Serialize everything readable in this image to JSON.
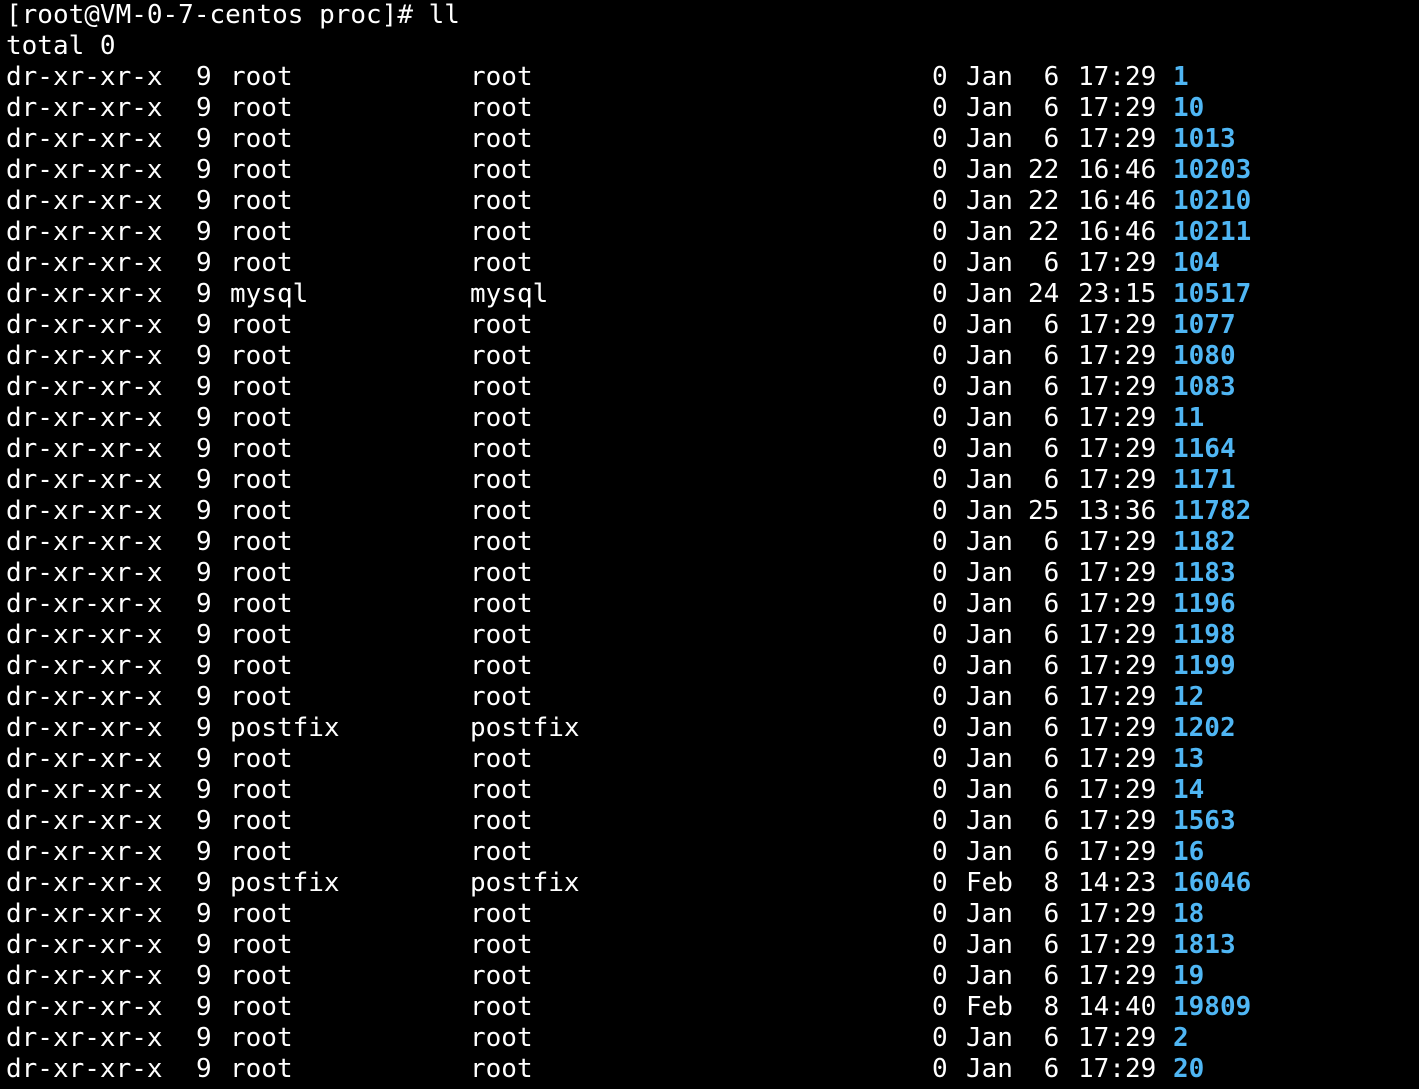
{
  "terminal": {
    "prompt": "[root@VM-0-7-centos proc]# ll",
    "total": "total 0",
    "dir_color": "#4fb6f4",
    "text_color": "#ffffff",
    "background": "#000000",
    "rows": [
      {
        "perms": "dr-xr-xr-x",
        "links": "9",
        "owner": "root",
        "group": "root",
        "size": "0",
        "month": "Jan",
        "day": "6",
        "time": "17:29",
        "name": "1"
      },
      {
        "perms": "dr-xr-xr-x",
        "links": "9",
        "owner": "root",
        "group": "root",
        "size": "0",
        "month": "Jan",
        "day": "6",
        "time": "17:29",
        "name": "10"
      },
      {
        "perms": "dr-xr-xr-x",
        "links": "9",
        "owner": "root",
        "group": "root",
        "size": "0",
        "month": "Jan",
        "day": "6",
        "time": "17:29",
        "name": "1013"
      },
      {
        "perms": "dr-xr-xr-x",
        "links": "9",
        "owner": "root",
        "group": "root",
        "size": "0",
        "month": "Jan",
        "day": "22",
        "time": "16:46",
        "name": "10203"
      },
      {
        "perms": "dr-xr-xr-x",
        "links": "9",
        "owner": "root",
        "group": "root",
        "size": "0",
        "month": "Jan",
        "day": "22",
        "time": "16:46",
        "name": "10210"
      },
      {
        "perms": "dr-xr-xr-x",
        "links": "9",
        "owner": "root",
        "group": "root",
        "size": "0",
        "month": "Jan",
        "day": "22",
        "time": "16:46",
        "name": "10211"
      },
      {
        "perms": "dr-xr-xr-x",
        "links": "9",
        "owner": "root",
        "group": "root",
        "size": "0",
        "month": "Jan",
        "day": "6",
        "time": "17:29",
        "name": "104"
      },
      {
        "perms": "dr-xr-xr-x",
        "links": "9",
        "owner": "mysql",
        "group": "mysql",
        "size": "0",
        "month": "Jan",
        "day": "24",
        "time": "23:15",
        "name": "10517"
      },
      {
        "perms": "dr-xr-xr-x",
        "links": "9",
        "owner": "root",
        "group": "root",
        "size": "0",
        "month": "Jan",
        "day": "6",
        "time": "17:29",
        "name": "1077"
      },
      {
        "perms": "dr-xr-xr-x",
        "links": "9",
        "owner": "root",
        "group": "root",
        "size": "0",
        "month": "Jan",
        "day": "6",
        "time": "17:29",
        "name": "1080"
      },
      {
        "perms": "dr-xr-xr-x",
        "links": "9",
        "owner": "root",
        "group": "root",
        "size": "0",
        "month": "Jan",
        "day": "6",
        "time": "17:29",
        "name": "1083"
      },
      {
        "perms": "dr-xr-xr-x",
        "links": "9",
        "owner": "root",
        "group": "root",
        "size": "0",
        "month": "Jan",
        "day": "6",
        "time": "17:29",
        "name": "11"
      },
      {
        "perms": "dr-xr-xr-x",
        "links": "9",
        "owner": "root",
        "group": "root",
        "size": "0",
        "month": "Jan",
        "day": "6",
        "time": "17:29",
        "name": "1164"
      },
      {
        "perms": "dr-xr-xr-x",
        "links": "9",
        "owner": "root",
        "group": "root",
        "size": "0",
        "month": "Jan",
        "day": "6",
        "time": "17:29",
        "name": "1171"
      },
      {
        "perms": "dr-xr-xr-x",
        "links": "9",
        "owner": "root",
        "group": "root",
        "size": "0",
        "month": "Jan",
        "day": "25",
        "time": "13:36",
        "name": "11782"
      },
      {
        "perms": "dr-xr-xr-x",
        "links": "9",
        "owner": "root",
        "group": "root",
        "size": "0",
        "month": "Jan",
        "day": "6",
        "time": "17:29",
        "name": "1182"
      },
      {
        "perms": "dr-xr-xr-x",
        "links": "9",
        "owner": "root",
        "group": "root",
        "size": "0",
        "month": "Jan",
        "day": "6",
        "time": "17:29",
        "name": "1183"
      },
      {
        "perms": "dr-xr-xr-x",
        "links": "9",
        "owner": "root",
        "group": "root",
        "size": "0",
        "month": "Jan",
        "day": "6",
        "time": "17:29",
        "name": "1196"
      },
      {
        "perms": "dr-xr-xr-x",
        "links": "9",
        "owner": "root",
        "group": "root",
        "size": "0",
        "month": "Jan",
        "day": "6",
        "time": "17:29",
        "name": "1198"
      },
      {
        "perms": "dr-xr-xr-x",
        "links": "9",
        "owner": "root",
        "group": "root",
        "size": "0",
        "month": "Jan",
        "day": "6",
        "time": "17:29",
        "name": "1199"
      },
      {
        "perms": "dr-xr-xr-x",
        "links": "9",
        "owner": "root",
        "group": "root",
        "size": "0",
        "month": "Jan",
        "day": "6",
        "time": "17:29",
        "name": "12"
      },
      {
        "perms": "dr-xr-xr-x",
        "links": "9",
        "owner": "postfix",
        "group": "postfix",
        "size": "0",
        "month": "Jan",
        "day": "6",
        "time": "17:29",
        "name": "1202"
      },
      {
        "perms": "dr-xr-xr-x",
        "links": "9",
        "owner": "root",
        "group": "root",
        "size": "0",
        "month": "Jan",
        "day": "6",
        "time": "17:29",
        "name": "13"
      },
      {
        "perms": "dr-xr-xr-x",
        "links": "9",
        "owner": "root",
        "group": "root",
        "size": "0",
        "month": "Jan",
        "day": "6",
        "time": "17:29",
        "name": "14"
      },
      {
        "perms": "dr-xr-xr-x",
        "links": "9",
        "owner": "root",
        "group": "root",
        "size": "0",
        "month": "Jan",
        "day": "6",
        "time": "17:29",
        "name": "1563"
      },
      {
        "perms": "dr-xr-xr-x",
        "links": "9",
        "owner": "root",
        "group": "root",
        "size": "0",
        "month": "Jan",
        "day": "6",
        "time": "17:29",
        "name": "16"
      },
      {
        "perms": "dr-xr-xr-x",
        "links": "9",
        "owner": "postfix",
        "group": "postfix",
        "size": "0",
        "month": "Feb",
        "day": "8",
        "time": "14:23",
        "name": "16046"
      },
      {
        "perms": "dr-xr-xr-x",
        "links": "9",
        "owner": "root",
        "group": "root",
        "size": "0",
        "month": "Jan",
        "day": "6",
        "time": "17:29",
        "name": "18"
      },
      {
        "perms": "dr-xr-xr-x",
        "links": "9",
        "owner": "root",
        "group": "root",
        "size": "0",
        "month": "Jan",
        "day": "6",
        "time": "17:29",
        "name": "1813"
      },
      {
        "perms": "dr-xr-xr-x",
        "links": "9",
        "owner": "root",
        "group": "root",
        "size": "0",
        "month": "Jan",
        "day": "6",
        "time": "17:29",
        "name": "19"
      },
      {
        "perms": "dr-xr-xr-x",
        "links": "9",
        "owner": "root",
        "group": "root",
        "size": "0",
        "month": "Feb",
        "day": "8",
        "time": "14:40",
        "name": "19809"
      },
      {
        "perms": "dr-xr-xr-x",
        "links": "9",
        "owner": "root",
        "group": "root",
        "size": "0",
        "month": "Jan",
        "day": "6",
        "time": "17:29",
        "name": "2"
      },
      {
        "perms": "dr-xr-xr-x",
        "links": "9",
        "owner": "root",
        "group": "root",
        "size": "0",
        "month": "Jan",
        "day": "6",
        "time": "17:29",
        "name": "20"
      }
    ]
  }
}
